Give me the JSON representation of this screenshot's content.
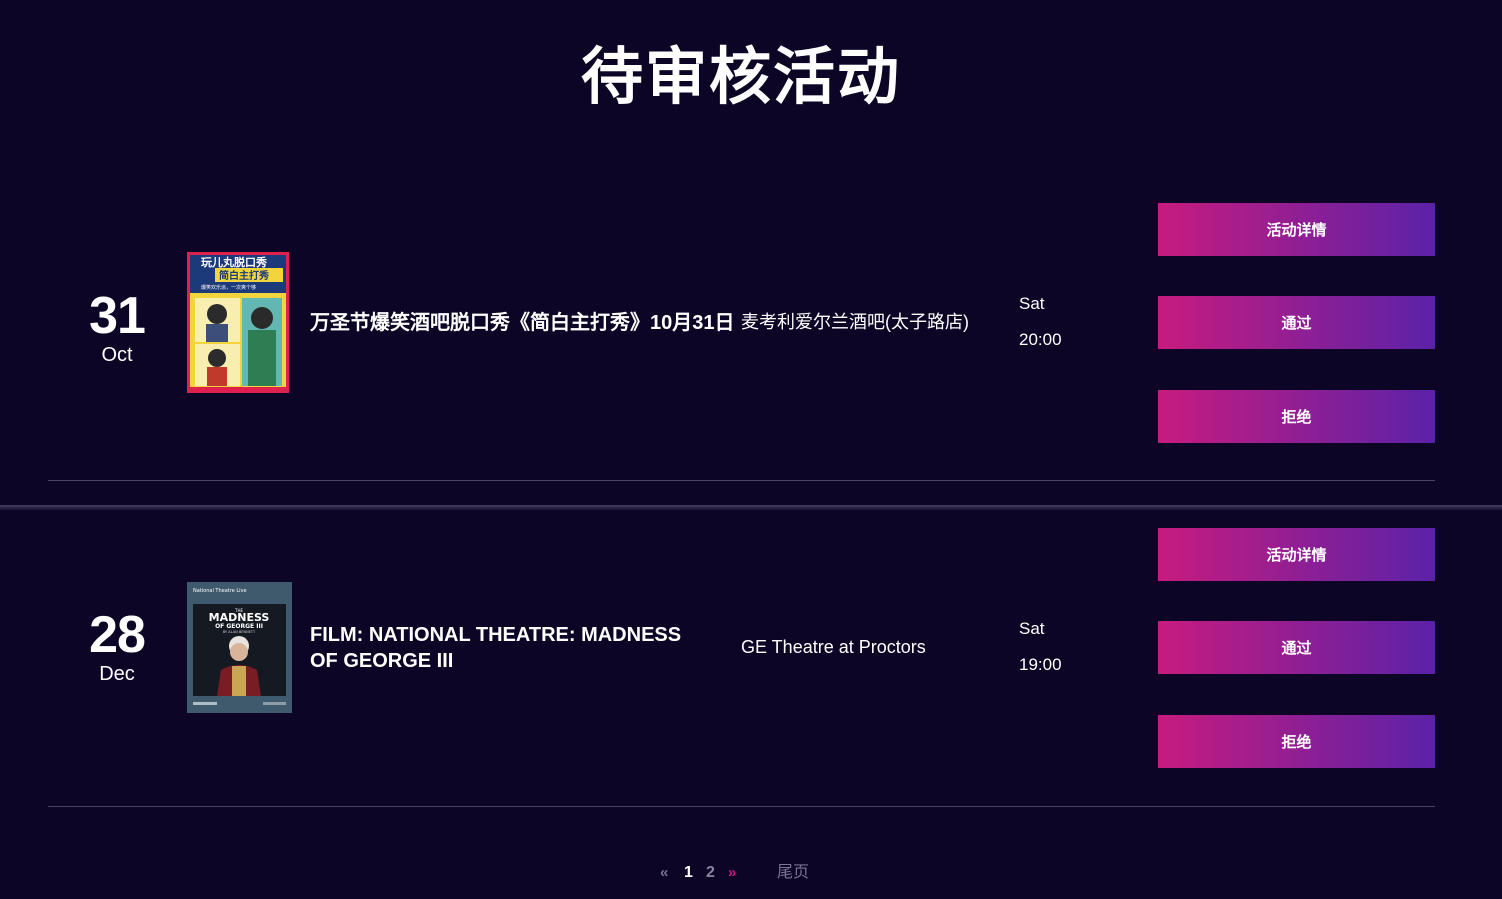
{
  "page": {
    "title": "待审核活动"
  },
  "events": [
    {
      "day": "31",
      "month": "Oct",
      "title": "万圣节爆笑酒吧脱口秀《简白主打秀》10月31日",
      "venue": "麦考利爱尔兰酒吧(太子路店)",
      "weekday": "Sat",
      "time": "20:00",
      "poster": {
        "headline": "玩儿丸脱口秀",
        "subhead": "简白主打秀",
        "tagline": "爆笑欢乐派，一次爽个够",
        "bg": "#f2d53c",
        "accent": "#e0214f"
      },
      "actions": {
        "details": "活动详情",
        "approve": "通过",
        "reject": "拒绝"
      }
    },
    {
      "day": "28",
      "month": "Dec",
      "title": "FILM: NATIONAL THEATRE: MADNESS OF GEORGE III",
      "venue": "GE Theatre at Proctors",
      "weekday": "Sat",
      "time": "19:00",
      "poster": {
        "brand": "National Theatre Live",
        "small": "THE",
        "headline": "MADNESS",
        "subhead": "OF GEORGE III",
        "byline": "BY ALAN BENNETT",
        "bg": "#3e5a6c"
      },
      "actions": {
        "details": "活动详情",
        "approve": "通过",
        "reject": "拒绝"
      }
    }
  ],
  "pagination": {
    "prev": "«",
    "pages": [
      "1",
      "2"
    ],
    "next": "»",
    "last": "尾页",
    "current": "1"
  },
  "colors": {
    "background": "#0c0526",
    "button_gradient_start": "#c81b7e",
    "button_gradient_end": "#5a22a8",
    "accent": "#c81b7e"
  }
}
